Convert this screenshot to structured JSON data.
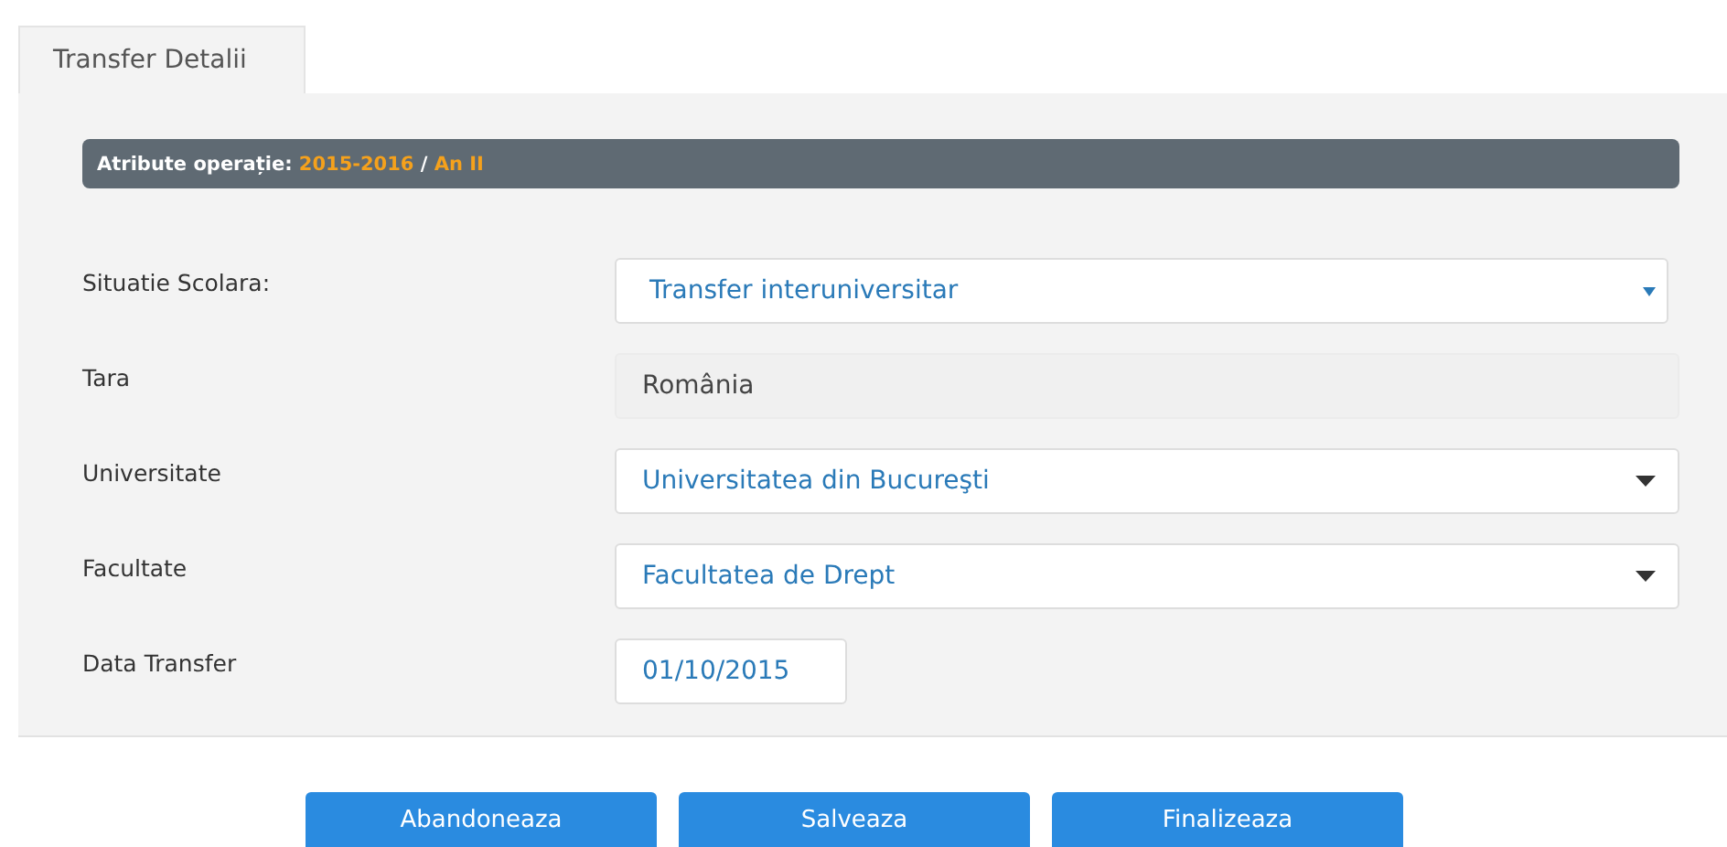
{
  "tabs": [
    {
      "label": "Transfer Detalii",
      "selected": true
    }
  ],
  "banner": {
    "label": "Atribute operație:",
    "year": "2015-2016",
    "separator": "/",
    "level": "An II"
  },
  "fields": [
    {
      "label": "Situatie Scolara:",
      "kind": "select-small",
      "value": "Transfer interuniversitar"
    },
    {
      "label": "Tara",
      "kind": "readonly",
      "value": "România"
    },
    {
      "label": "Universitate",
      "kind": "select",
      "value": "Universitatea din Bucureşti"
    },
    {
      "label": "Facultate",
      "kind": "select",
      "value": "Facultatea de Drept"
    },
    {
      "label": "Data Transfer",
      "kind": "date",
      "value": "01/10/2015"
    }
  ],
  "buttons": [
    "Abandoneaza",
    "Salveaza",
    "Finalizeaza"
  ]
}
